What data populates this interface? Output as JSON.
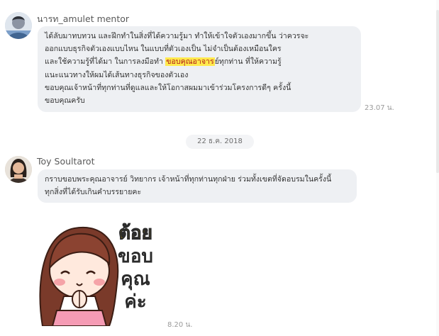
{
  "messages": [
    {
      "sender": "นารท_amulet mentor",
      "lines": [
        "ได้ลับมาทบทวน และฝึกทำในสิ่งที่ได้ความรู้มา ทำให้เข้าใจตัวเองมากขึ้น ว่าควรจะ",
        "ออกแบบธุรกิจตัวเองแบบไหน ในแบบที่ตัวเองเป็น ไม่จำเป็นต้องเหมือนใคร",
        "และใช้ความรู้ที่ได้มา ในการลงมือทำ ",
        "แนะแนวทางให้ผมได้เส้นทางธุรกิจของตัวเอง",
        "ขอบคุณเจ้าหน้าที่ทุกท่านที่ดูแลและให้โอกาสผมมาเข้าร่วมโครงการดีๆ ครั้งนี้",
        "ขอบคุณครับ"
      ],
      "highlight": "ขอบคุณอาจาร",
      "after_highlight": "ย์ทุกท่าน ที่ให้ความรู้",
      "time": "23.07 น."
    },
    {
      "sender": "Toy Soultarot",
      "lines": [
        "กราบขอบพระคุณอาจารย์ วิทยากร เจ้าหน้าที่ทุกท่านทุกฝ่าย ร่วมทั้งเขตที่จัดอบรมในครั้งนี้",
        "ทุกสิ่งที่ได้รับเกินคำบรรยายคะ"
      ],
      "time": "8.20 น."
    }
  ],
  "date_divider": "22 ธ.ค. 2018",
  "sticker": {
    "text_lines": [
      "ต้อย",
      "ขอบ",
      "คุณ",
      "ค่ะ"
    ],
    "name_color": "#c8a800",
    "text_color": "#2b2b2b",
    "icon": "girl-thank-you-sticker"
  },
  "colors": {
    "bubble": "#eef0f3",
    "highlight_bg": "#ffe94d",
    "highlight_text": "#b01b1b"
  }
}
